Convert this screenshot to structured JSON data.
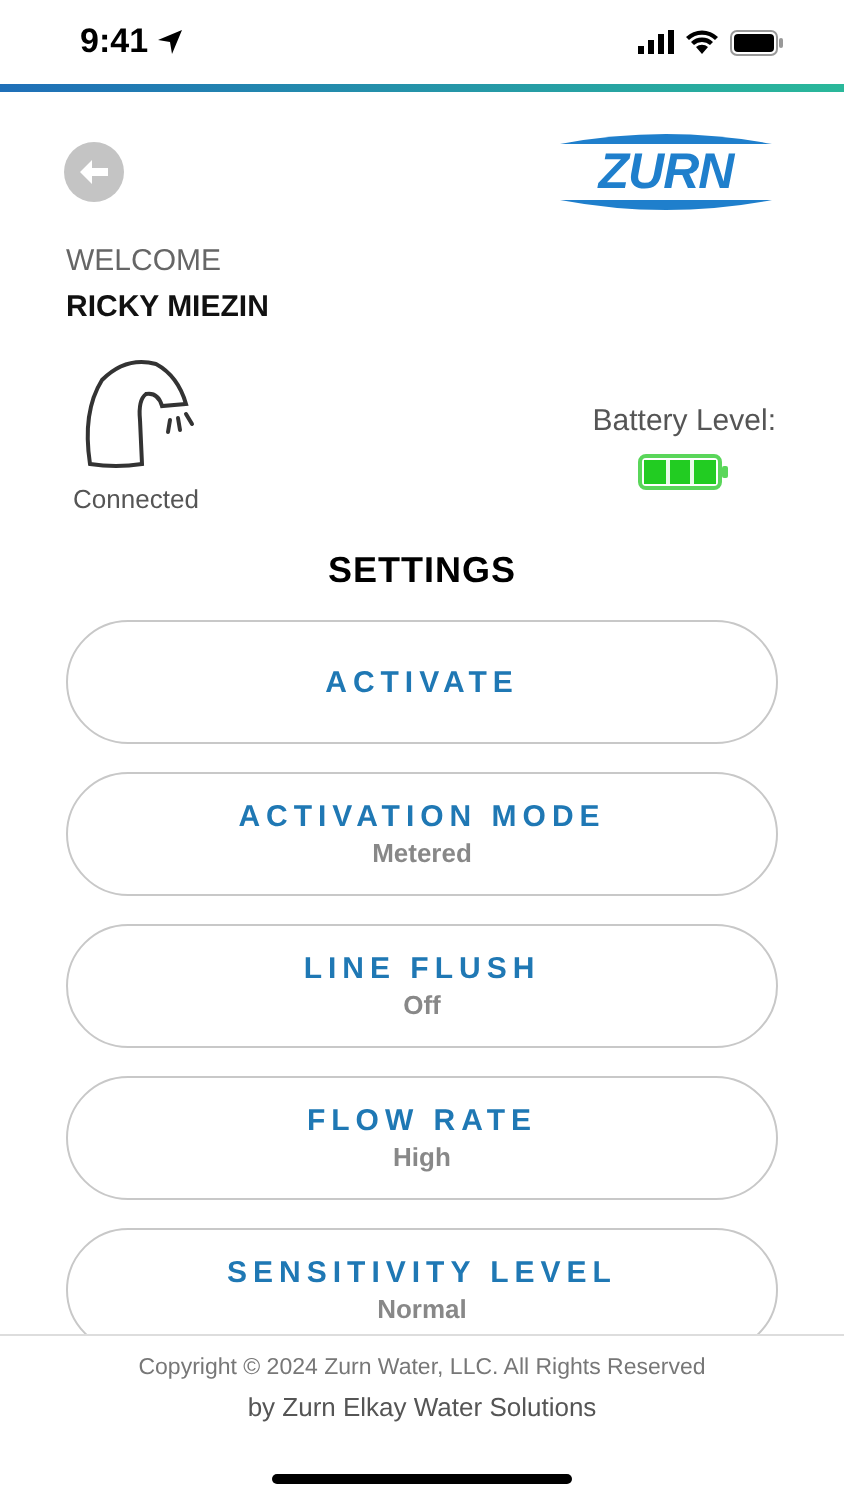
{
  "status_bar": {
    "time": "9:41"
  },
  "header": {
    "logo": "ZURN"
  },
  "welcome": {
    "label": "WELCOME",
    "name": "RICKY MIEZIN"
  },
  "device": {
    "status": "Connected"
  },
  "battery": {
    "label": "Battery Level:",
    "level": 1
  },
  "settings": {
    "title": "SETTINGS",
    "items": [
      {
        "label": "ACTIVATE"
      },
      {
        "label": "ACTIVATION MODE",
        "value": "Metered"
      },
      {
        "label": "LINE FLUSH",
        "value": "Off"
      },
      {
        "label": "FLOW RATE",
        "value": "High"
      },
      {
        "label": "SENSITIVITY LEVEL",
        "value": "Normal"
      }
    ]
  },
  "footer": {
    "copyright": "Copyright © 2024 Zurn Water, LLC. All Rights Reserved",
    "byline": "by Zurn Elkay Water Solutions"
  }
}
